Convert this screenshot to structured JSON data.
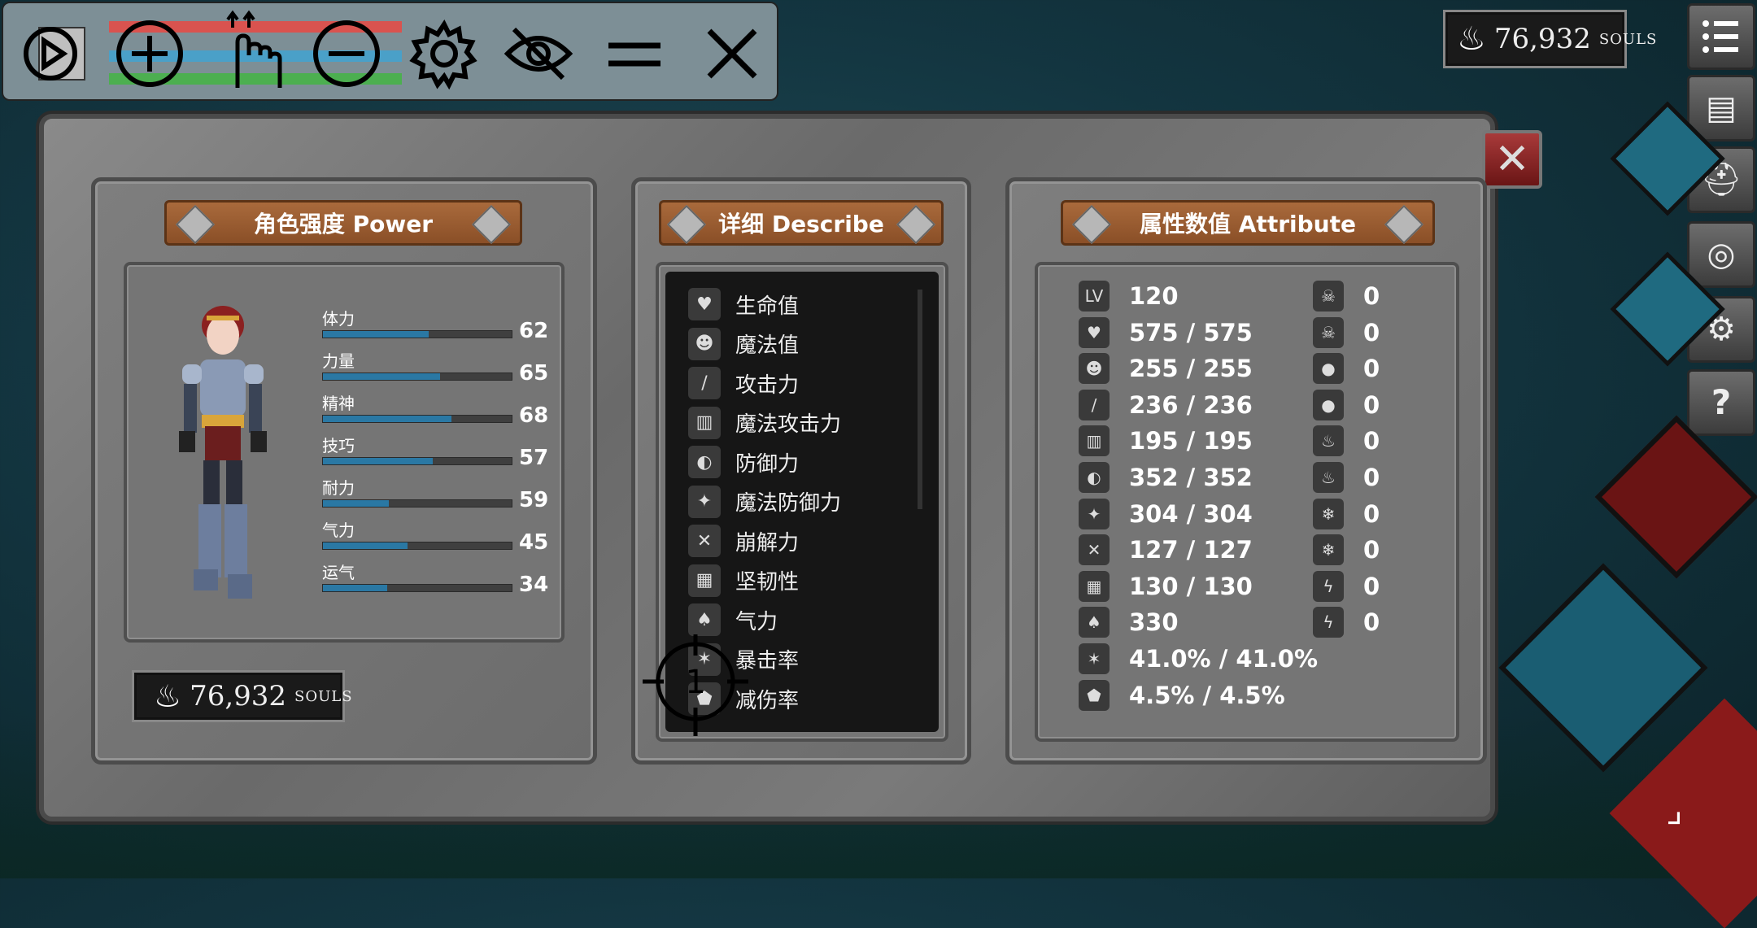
{
  "toolbar": {
    "icons": [
      "play-icon",
      "plus-circle-icon",
      "tap-hand-icon",
      "minus-circle-icon",
      "gear-icon",
      "eye-off-icon",
      "equals-icon",
      "close-icon"
    ]
  },
  "top_souls": {
    "value": "76,932",
    "unit": "SOULS"
  },
  "panel_souls": {
    "value": "76,932",
    "unit": "SOULS"
  },
  "power": {
    "title": "角色强度 Power",
    "stats": [
      {
        "label": "体力",
        "value": "62",
        "fill": 0.56
      },
      {
        "label": "力量",
        "value": "65",
        "fill": 0.62
      },
      {
        "label": "精神",
        "value": "68",
        "fill": 0.68
      },
      {
        "label": "技巧",
        "value": "57",
        "fill": 0.58
      },
      {
        "label": "耐力",
        "value": "59",
        "fill": 0.35
      },
      {
        "label": "气力",
        "value": "45",
        "fill": 0.45
      },
      {
        "label": "运气",
        "value": "34",
        "fill": 0.34
      }
    ]
  },
  "describe": {
    "title": "详细 Describe",
    "items": [
      {
        "icon": "heart-icon",
        "label": "生命值"
      },
      {
        "icon": "head-icon",
        "label": "魔法值"
      },
      {
        "icon": "sword-icon",
        "label": "攻击力"
      },
      {
        "icon": "spellbook-icon",
        "label": "魔法攻击力"
      },
      {
        "icon": "shield-icon",
        "label": "防御力"
      },
      {
        "icon": "magic-shield-icon",
        "label": "魔法防御力"
      },
      {
        "icon": "break-icon",
        "label": "崩解力"
      },
      {
        "icon": "helmet-icon",
        "label": "坚韧性"
      },
      {
        "icon": "lungs-icon",
        "label": "气力"
      },
      {
        "icon": "crit-star-icon",
        "label": "暴击率"
      },
      {
        "icon": "damage-reduce-icon",
        "label": "减伤率"
      }
    ]
  },
  "attribute": {
    "title": "属性数值 Attribute",
    "left": [
      {
        "icon": "level-icon",
        "icon_text": "LV",
        "value": "120"
      },
      {
        "icon": "heart-icon",
        "icon_text": "♥",
        "value": "575 / 575"
      },
      {
        "icon": "head-icon",
        "icon_text": "☻",
        "value": "255 / 255"
      },
      {
        "icon": "sword-icon",
        "icon_text": "/",
        "value": "236 / 236"
      },
      {
        "icon": "spellbook-icon",
        "icon_text": "▥",
        "value": "195 / 195"
      },
      {
        "icon": "shield-icon",
        "icon_text": "◐",
        "value": "352 / 352"
      },
      {
        "icon": "magic-shield-icon",
        "icon_text": "✦",
        "value": "304 / 304"
      },
      {
        "icon": "break-icon",
        "icon_text": "✕",
        "value": "127 / 127"
      },
      {
        "icon": "helmet-icon",
        "icon_text": "▦",
        "value": "130 / 130"
      },
      {
        "icon": "lungs-icon",
        "icon_text": "♠",
        "value": "330"
      },
      {
        "icon": "crit-star-icon",
        "icon_text": "✶",
        "value": "41.0% / 41.0%"
      },
      {
        "icon": "damage-reduce-icon",
        "icon_text": "⬟",
        "value": "4.5% / 4.5%"
      }
    ],
    "right": [
      {
        "icon": "skull-icon",
        "icon_text": "☠",
        "value": "0"
      },
      {
        "icon": "skull-resist-icon",
        "icon_text": "☠",
        "value": "0"
      },
      {
        "icon": "drop-icon",
        "icon_text": "●",
        "value": "0"
      },
      {
        "icon": "drop-resist-icon",
        "icon_text": "●",
        "value": "0"
      },
      {
        "icon": "fire-icon",
        "icon_text": "♨",
        "value": "0"
      },
      {
        "icon": "fire-resist-icon",
        "icon_text": "♨",
        "value": "0"
      },
      {
        "icon": "snowflake-icon",
        "icon_text": "❄",
        "value": "0"
      },
      {
        "icon": "snowflake-resist-icon",
        "icon_text": "❄",
        "value": "0"
      },
      {
        "icon": "lightning-icon",
        "icon_text": "ϟ",
        "value": "0"
      },
      {
        "icon": "lightning-resist-icon",
        "icon_text": "ϟ",
        "value": "0"
      }
    ]
  },
  "overlay": {
    "cursor_number": "1"
  }
}
